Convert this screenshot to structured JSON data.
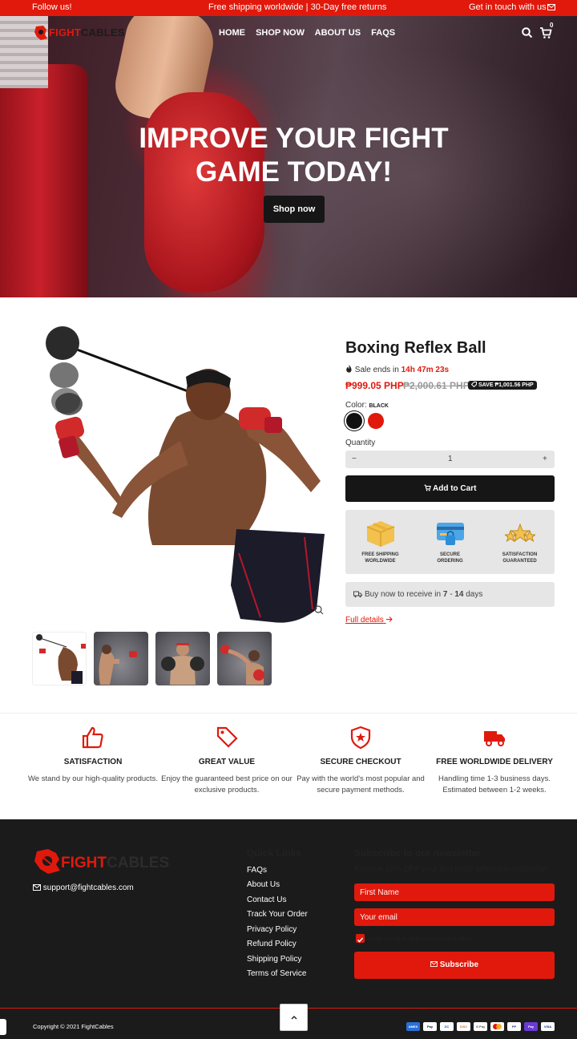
{
  "announcement": {
    "left": "Follow us!",
    "center": "Free shipping worldwide | 30-Day free returns",
    "right": "Get in touch with us"
  },
  "header": {
    "logo_fight": "FIGHT",
    "logo_cables": "CABLES",
    "nav": [
      "HOME",
      "SHOP NOW",
      "ABOUT US",
      "FAQS"
    ],
    "cart_count": "0",
    "icons": [
      "search-icon",
      "cart-icon",
      "mail-icon"
    ]
  },
  "hero": {
    "title_line1": "IMPROVE YOUR FIGHT",
    "title_line2": "GAME TODAY!",
    "button": "Shop now"
  },
  "product": {
    "title": "Boxing Reflex Ball",
    "sale_prefix": "Sale ends in",
    "sale_timer": "14h 47m 23s",
    "price": "₱999.05 PHP",
    "price_old": "₱2,000.61 PHP",
    "save_badge": "SAVE ₱1,001.56 PHP",
    "color_label": "Color:",
    "color_value": "BLACK",
    "colors": [
      "#111111",
      "#e0190c"
    ],
    "quantity_label": "Quantity",
    "quantity": "1",
    "minus": "−",
    "plus": "+",
    "add_to_cart": "Add to Cart",
    "badges": [
      {
        "line1": "FREE SHIPPING",
        "line2": "WORLDWIDE"
      },
      {
        "line1": "SECURE",
        "line2": "ORDERING"
      },
      {
        "line1": "SATISFACTION",
        "line2": "GUARANTEED"
      }
    ],
    "delivery_prefix": "Buy now to receive in",
    "delivery_from": "7",
    "delivery_sep": "-",
    "delivery_to": "14",
    "delivery_suffix": "days",
    "full_details": "Full details"
  },
  "features": [
    {
      "title": "SATISFACTION",
      "desc": "We stand by our high-quality products."
    },
    {
      "title": "GREAT VALUE",
      "desc": "Enjoy the guaranteed best price on our exclusive products."
    },
    {
      "title": "SECURE CHECKOUT",
      "desc": "Pay with the world's most popular and secure payment methods."
    },
    {
      "title": "FREE WORLDWIDE DELIVERY",
      "desc": "Handling time 1-3 business days. Estimated between 1-2 weeks."
    }
  ],
  "footer": {
    "logo_fight": "FIGHT",
    "logo_cables": "CABLES",
    "email": "support@fightcables.com",
    "quick_links_title": "Quick Links",
    "quick_links": [
      "FAQs",
      "About Us",
      "Contact Us",
      "Track Your Order",
      "Privacy Policy",
      "Refund Policy",
      "Shipping Policy",
      "Terms of Service"
    ],
    "newsletter_title": "Subscribe to our newsletter",
    "newsletter_sub": "Receive 10% OFF your first order when you subscribe!",
    "first_name_placeholder": "First Name",
    "email_placeholder": "Your email",
    "checkbox_label": "Keep me up to date on news and offers",
    "subscribe": "Subscribe",
    "copyright": "Copyright © 2021 FightCables",
    "payments": [
      "AMEX",
      "Pay",
      "DC",
      "DISC",
      "G Pay",
      "MC",
      "PP",
      "Pay",
      "VISA"
    ],
    "accent": "#e0190c"
  }
}
